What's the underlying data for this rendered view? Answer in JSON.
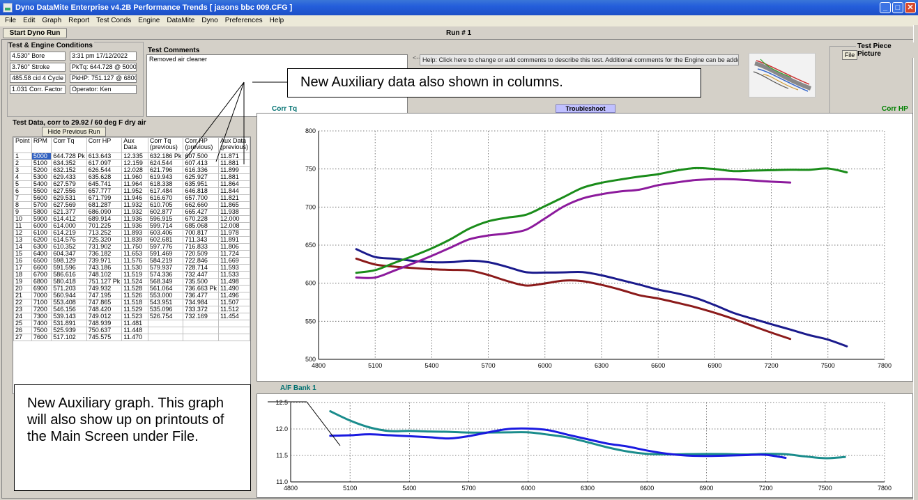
{
  "window": {
    "title": "Dyno DataMite Enterprise v4.2B   Performance Trends   [ jasons bbc 009.CFG ]",
    "min_glyph": "_",
    "max_glyph": "□",
    "close_glyph": "✕"
  },
  "menu": [
    "File",
    "Edit",
    "Graph",
    "Report",
    "Test Conds",
    "Engine",
    "DataMite",
    "Dyno",
    "Preferences",
    "Help"
  ],
  "toolbar": {
    "start_label": "Start Dyno Run",
    "run_label": "Run # 1"
  },
  "engine": {
    "title": "Test & Engine Conditions",
    "bore": "4.530\" Bore",
    "stroke": "3.760\" Stroke",
    "cid": "485.58 cid 4 Cycle",
    "corr_factor": "1.031 Corr. Factor",
    "datetime": "3:31 pm 17/12/2022",
    "pk_tq": "PkTq: 644.728 @ 5000",
    "pk_hp": "PkHP: 751.127 @ 6800",
    "operator": "Operator: Ken"
  },
  "comments": {
    "title": "Test Comments",
    "text": "Removed air cleaner",
    "help_arrow": "<--",
    "help": "Help:  Click here to change or add comments to describe this test.  Additional comments for the Engine can be added in the Engine"
  },
  "picture": {
    "title": "Test Piece Picture",
    "file_label": "File"
  },
  "callouts": {
    "top": "New Auxiliary data also shown in columns.",
    "bottom": "New Auxiliary graph. This graph will also show up on printouts of the Main Screen under File."
  },
  "test_data": {
    "title": "Test Data, corr to 29.92 / 60 deg F dry air",
    "hide_label": "Hide Previous Run",
    "columns": [
      "Point",
      "RPM",
      "Corr Tq",
      "Corr HP",
      "Aux Data",
      "Corr Tq (previous)",
      "Corr HP (previous)",
      "Aux Data (previous)"
    ],
    "rows": [
      [
        "1",
        "5000",
        "644.728 Pk",
        "613.643",
        "12.335",
        "632.186 Pk",
        "607.500",
        "11.871"
      ],
      [
        "2",
        "5100",
        "634.352",
        "617.097",
        "12.159",
        "624.544",
        "607.413",
        "11.881"
      ],
      [
        "3",
        "5200",
        "632.152",
        "626.544",
        "12.028",
        "621.796",
        "616.336",
        "11.899"
      ],
      [
        "4",
        "5300",
        "629.433",
        "635.628",
        "11.960",
        "619.943",
        "625.927",
        "11.881"
      ],
      [
        "5",
        "5400",
        "627.579",
        "645.741",
        "11.964",
        "618.338",
        "635.951",
        "11.864"
      ],
      [
        "6",
        "5500",
        "627.556",
        "657.777",
        "11.952",
        "617.484",
        "646.818",
        "11.844"
      ],
      [
        "7",
        "5600",
        "629.531",
        "671.799",
        "11.946",
        "616.670",
        "657.700",
        "11.821"
      ],
      [
        "8",
        "5700",
        "627.569",
        "681.287",
        "11.932",
        "610.705",
        "662.660",
        "11.865"
      ],
      [
        "9",
        "5800",
        "621.377",
        "686.090",
        "11.932",
        "602.877",
        "665.427",
        "11.938"
      ],
      [
        "10",
        "5900",
        "614.412",
        "689.914",
        "11.936",
        "596.915",
        "670.228",
        "12.000"
      ],
      [
        "11",
        "6000",
        "614.000",
        "701.225",
        "11.936",
        "599.714",
        "685.068",
        "12.008"
      ],
      [
        "12",
        "6100",
        "614.219",
        "713.252",
        "11.893",
        "603.406",
        "700.817",
        "11.978"
      ],
      [
        "13",
        "6200",
        "614.576",
        "725.320",
        "11.839",
        "602.681",
        "711.343",
        "11.891"
      ],
      [
        "14",
        "6300",
        "610.352",
        "731.902",
        "11.750",
        "597.776",
        "716.833",
        "11.806"
      ],
      [
        "15",
        "6400",
        "604.347",
        "736.182",
        "11.653",
        "591.469",
        "720.509",
        "11.724"
      ],
      [
        "16",
        "6500",
        "598.129",
        "739.971",
        "11.576",
        "584.219",
        "722.846",
        "11.669"
      ],
      [
        "17",
        "6600",
        "591.596",
        "743.186",
        "11.530",
        "579.937",
        "728.714",
        "11.593"
      ],
      [
        "18",
        "6700",
        "586.616",
        "748.102",
        "11.519",
        "574.336",
        "732.447",
        "11.533"
      ],
      [
        "19",
        "6800",
        "580.418",
        "751.127 Pk",
        "11.524",
        "568.349",
        "735.500",
        "11.498"
      ],
      [
        "20",
        "6900",
        "571.203",
        "749.932",
        "11.528",
        "561.064",
        "736.663 Pk",
        "11.490"
      ],
      [
        "21",
        "7000",
        "560.944",
        "747.195",
        "11.526",
        "553.000",
        "736.477",
        "11.496"
      ],
      [
        "22",
        "7100",
        "553.408",
        "747.865",
        "11.518",
        "543.951",
        "734.984",
        "11.507"
      ],
      [
        "23",
        "7200",
        "546.156",
        "748.420",
        "11.529",
        "535.096",
        "733.372",
        "11.512"
      ],
      [
        "24",
        "7300",
        "539.143",
        "749.012",
        "11.523",
        "526.754",
        "732.169",
        "11.454"
      ],
      [
        "25",
        "7400",
        "531.891",
        "748.939",
        "11.481",
        "",
        "",
        ""
      ],
      [
        "26",
        "7500",
        "525.939",
        "750.637",
        "11.448",
        "",
        "",
        ""
      ],
      [
        "27",
        "7600",
        "517.102",
        "745.575",
        "11.470",
        "",
        "",
        ""
      ]
    ]
  },
  "graph_top_header": {
    "left": "Corr Tq",
    "button": "Troubleshoot",
    "right": "Corr HP"
  },
  "graph_bottom_header": {
    "left": "A/F Bank 1"
  },
  "colors": {
    "tq_current": "#1a1a8c",
    "tq_previous": "#8b1a1a",
    "hp_current": "#1a8c1a",
    "hp_previous": "#8c1a9c",
    "af_current": "#1a1ae0",
    "af_previous": "#1a8c8c"
  },
  "chart_data": [
    {
      "type": "line",
      "title": "",
      "xlabel": "",
      "ylabel": "",
      "x_ticks": [
        4800,
        5100,
        5400,
        5700,
        6000,
        6300,
        6600,
        6900,
        7200,
        7500,
        7800
      ],
      "y_ticks": [
        500,
        550,
        600,
        650,
        700,
        750,
        800
      ],
      "xlim": [
        4800,
        7800
      ],
      "ylim": [
        500,
        800
      ],
      "grid": true,
      "series": [
        {
          "name": "Corr Tq",
          "x": [
            5000,
            5100,
            5200,
            5300,
            5400,
            5500,
            5600,
            5700,
            5800,
            5900,
            6000,
            6100,
            6200,
            6300,
            6400,
            6500,
            6600,
            6700,
            6800,
            6900,
            7000,
            7100,
            7200,
            7300,
            7400,
            7500,
            7600
          ],
          "values": [
            644.728,
            634.352,
            632.152,
            629.433,
            627.579,
            627.556,
            629.531,
            627.569,
            621.377,
            614.412,
            614.0,
            614.219,
            614.576,
            610.352,
            604.347,
            598.129,
            591.596,
            586.616,
            580.418,
            571.203,
            560.944,
            553.408,
            546.156,
            539.143,
            531.891,
            525.939,
            517.102
          ]
        },
        {
          "name": "Corr Tq (previous)",
          "x": [
            5000,
            5100,
            5200,
            5300,
            5400,
            5500,
            5600,
            5700,
            5800,
            5900,
            6000,
            6100,
            6200,
            6300,
            6400,
            6500,
            6600,
            6700,
            6800,
            6900,
            7000,
            7100,
            7200,
            7300
          ],
          "values": [
            632.186,
            624.544,
            621.796,
            619.943,
            618.338,
            617.484,
            616.67,
            610.705,
            602.877,
            596.915,
            599.714,
            603.406,
            602.681,
            597.776,
            591.469,
            584.219,
            579.937,
            574.336,
            568.349,
            561.064,
            553.0,
            543.951,
            535.096,
            526.754
          ]
        },
        {
          "name": "Corr HP",
          "x": [
            5000,
            5100,
            5200,
            5300,
            5400,
            5500,
            5600,
            5700,
            5800,
            5900,
            6000,
            6100,
            6200,
            6300,
            6400,
            6500,
            6600,
            6700,
            6800,
            6900,
            7000,
            7100,
            7200,
            7300,
            7400,
            7500,
            7600
          ],
          "values": [
            613.643,
            617.097,
            626.544,
            635.628,
            645.741,
            657.777,
            671.799,
            681.287,
            686.09,
            689.914,
            701.225,
            713.252,
            725.32,
            731.902,
            736.182,
            739.971,
            743.186,
            748.102,
            751.127,
            749.932,
            747.195,
            747.865,
            748.42,
            749.012,
            748.939,
            750.637,
            745.575
          ]
        },
        {
          "name": "Corr HP (previous)",
          "x": [
            5000,
            5100,
            5200,
            5300,
            5400,
            5500,
            5600,
            5700,
            5800,
            5900,
            6000,
            6100,
            6200,
            6300,
            6400,
            6500,
            6600,
            6700,
            6800,
            6900,
            7000,
            7100,
            7200,
            7300
          ],
          "values": [
            607.5,
            607.413,
            616.336,
            625.927,
            635.951,
            646.818,
            657.7,
            662.66,
            665.427,
            670.228,
            685.068,
            700.817,
            711.343,
            716.833,
            720.509,
            722.846,
            728.714,
            732.447,
            735.5,
            736.663,
            736.477,
            734.984,
            733.372,
            732.169
          ]
        }
      ]
    },
    {
      "type": "line",
      "title": "A/F Bank 1",
      "xlabel": "",
      "ylabel": "",
      "x_ticks": [
        4800,
        5100,
        5400,
        5700,
        6000,
        6300,
        6600,
        6900,
        7200,
        7500,
        7800
      ],
      "y_ticks": [
        11.0,
        11.5,
        12.0,
        12.5
      ],
      "y_tick_labels": [
        "11.0",
        "11.5",
        "12.0",
        "12.5"
      ],
      "xlim": [
        4800,
        7800
      ],
      "ylim": [
        11.0,
        12.5
      ],
      "grid": true,
      "series": [
        {
          "name": "Aux Data",
          "x": [
            5000,
            5100,
            5200,
            5300,
            5400,
            5500,
            5600,
            5700,
            5800,
            5900,
            6000,
            6100,
            6200,
            6300,
            6400,
            6500,
            6600,
            6700,
            6800,
            6900,
            7000,
            7100,
            7200,
            7300,
            7400,
            7500,
            7600
          ],
          "values": [
            12.335,
            12.159,
            12.028,
            11.96,
            11.964,
            11.952,
            11.946,
            11.932,
            11.932,
            11.936,
            11.936,
            11.893,
            11.839,
            11.75,
            11.653,
            11.576,
            11.53,
            11.519,
            11.524,
            11.528,
            11.526,
            11.518,
            11.529,
            11.523,
            11.481,
            11.448,
            11.47
          ]
        },
        {
          "name": "Aux Data (previous)",
          "x": [
            5000,
            5100,
            5200,
            5300,
            5400,
            5500,
            5600,
            5700,
            5800,
            5900,
            6000,
            6100,
            6200,
            6300,
            6400,
            6500,
            6600,
            6700,
            6800,
            6900,
            7000,
            7100,
            7200,
            7300
          ],
          "values": [
            11.871,
            11.881,
            11.899,
            11.881,
            11.864,
            11.844,
            11.821,
            11.865,
            11.938,
            12.0,
            12.008,
            11.978,
            11.891,
            11.806,
            11.724,
            11.669,
            11.593,
            11.533,
            11.498,
            11.49,
            11.496,
            11.507,
            11.512,
            11.454
          ]
        }
      ]
    }
  ]
}
